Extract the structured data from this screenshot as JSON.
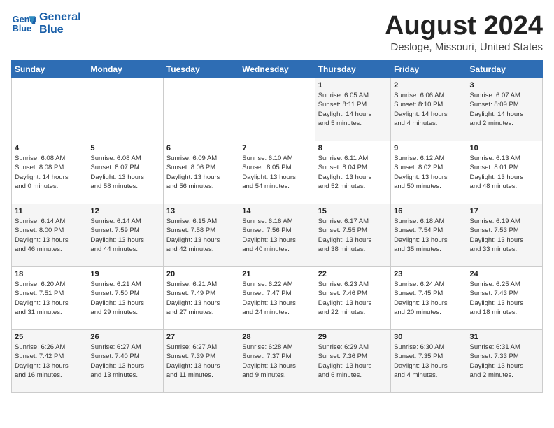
{
  "header": {
    "logo_line1": "General",
    "logo_line2": "Blue",
    "month_title": "August 2024",
    "location": "Desloge, Missouri, United States"
  },
  "days_of_week": [
    "Sunday",
    "Monday",
    "Tuesday",
    "Wednesday",
    "Thursday",
    "Friday",
    "Saturday"
  ],
  "weeks": [
    [
      {
        "day": "",
        "info": ""
      },
      {
        "day": "",
        "info": ""
      },
      {
        "day": "",
        "info": ""
      },
      {
        "day": "",
        "info": ""
      },
      {
        "day": "1",
        "info": "Sunrise: 6:05 AM\nSunset: 8:11 PM\nDaylight: 14 hours\nand 5 minutes."
      },
      {
        "day": "2",
        "info": "Sunrise: 6:06 AM\nSunset: 8:10 PM\nDaylight: 14 hours\nand 4 minutes."
      },
      {
        "day": "3",
        "info": "Sunrise: 6:07 AM\nSunset: 8:09 PM\nDaylight: 14 hours\nand 2 minutes."
      }
    ],
    [
      {
        "day": "4",
        "info": "Sunrise: 6:08 AM\nSunset: 8:08 PM\nDaylight: 14 hours\nand 0 minutes."
      },
      {
        "day": "5",
        "info": "Sunrise: 6:08 AM\nSunset: 8:07 PM\nDaylight: 13 hours\nand 58 minutes."
      },
      {
        "day": "6",
        "info": "Sunrise: 6:09 AM\nSunset: 8:06 PM\nDaylight: 13 hours\nand 56 minutes."
      },
      {
        "day": "7",
        "info": "Sunrise: 6:10 AM\nSunset: 8:05 PM\nDaylight: 13 hours\nand 54 minutes."
      },
      {
        "day": "8",
        "info": "Sunrise: 6:11 AM\nSunset: 8:04 PM\nDaylight: 13 hours\nand 52 minutes."
      },
      {
        "day": "9",
        "info": "Sunrise: 6:12 AM\nSunset: 8:02 PM\nDaylight: 13 hours\nand 50 minutes."
      },
      {
        "day": "10",
        "info": "Sunrise: 6:13 AM\nSunset: 8:01 PM\nDaylight: 13 hours\nand 48 minutes."
      }
    ],
    [
      {
        "day": "11",
        "info": "Sunrise: 6:14 AM\nSunset: 8:00 PM\nDaylight: 13 hours\nand 46 minutes."
      },
      {
        "day": "12",
        "info": "Sunrise: 6:14 AM\nSunset: 7:59 PM\nDaylight: 13 hours\nand 44 minutes."
      },
      {
        "day": "13",
        "info": "Sunrise: 6:15 AM\nSunset: 7:58 PM\nDaylight: 13 hours\nand 42 minutes."
      },
      {
        "day": "14",
        "info": "Sunrise: 6:16 AM\nSunset: 7:56 PM\nDaylight: 13 hours\nand 40 minutes."
      },
      {
        "day": "15",
        "info": "Sunrise: 6:17 AM\nSunset: 7:55 PM\nDaylight: 13 hours\nand 38 minutes."
      },
      {
        "day": "16",
        "info": "Sunrise: 6:18 AM\nSunset: 7:54 PM\nDaylight: 13 hours\nand 35 minutes."
      },
      {
        "day": "17",
        "info": "Sunrise: 6:19 AM\nSunset: 7:53 PM\nDaylight: 13 hours\nand 33 minutes."
      }
    ],
    [
      {
        "day": "18",
        "info": "Sunrise: 6:20 AM\nSunset: 7:51 PM\nDaylight: 13 hours\nand 31 minutes."
      },
      {
        "day": "19",
        "info": "Sunrise: 6:21 AM\nSunset: 7:50 PM\nDaylight: 13 hours\nand 29 minutes."
      },
      {
        "day": "20",
        "info": "Sunrise: 6:21 AM\nSunset: 7:49 PM\nDaylight: 13 hours\nand 27 minutes."
      },
      {
        "day": "21",
        "info": "Sunrise: 6:22 AM\nSunset: 7:47 PM\nDaylight: 13 hours\nand 24 minutes."
      },
      {
        "day": "22",
        "info": "Sunrise: 6:23 AM\nSunset: 7:46 PM\nDaylight: 13 hours\nand 22 minutes."
      },
      {
        "day": "23",
        "info": "Sunrise: 6:24 AM\nSunset: 7:45 PM\nDaylight: 13 hours\nand 20 minutes."
      },
      {
        "day": "24",
        "info": "Sunrise: 6:25 AM\nSunset: 7:43 PM\nDaylight: 13 hours\nand 18 minutes."
      }
    ],
    [
      {
        "day": "25",
        "info": "Sunrise: 6:26 AM\nSunset: 7:42 PM\nDaylight: 13 hours\nand 16 minutes."
      },
      {
        "day": "26",
        "info": "Sunrise: 6:27 AM\nSunset: 7:40 PM\nDaylight: 13 hours\nand 13 minutes."
      },
      {
        "day": "27",
        "info": "Sunrise: 6:27 AM\nSunset: 7:39 PM\nDaylight: 13 hours\nand 11 minutes."
      },
      {
        "day": "28",
        "info": "Sunrise: 6:28 AM\nSunset: 7:37 PM\nDaylight: 13 hours\nand 9 minutes."
      },
      {
        "day": "29",
        "info": "Sunrise: 6:29 AM\nSunset: 7:36 PM\nDaylight: 13 hours\nand 6 minutes."
      },
      {
        "day": "30",
        "info": "Sunrise: 6:30 AM\nSunset: 7:35 PM\nDaylight: 13 hours\nand 4 minutes."
      },
      {
        "day": "31",
        "info": "Sunrise: 6:31 AM\nSunset: 7:33 PM\nDaylight: 13 hours\nand 2 minutes."
      }
    ]
  ]
}
